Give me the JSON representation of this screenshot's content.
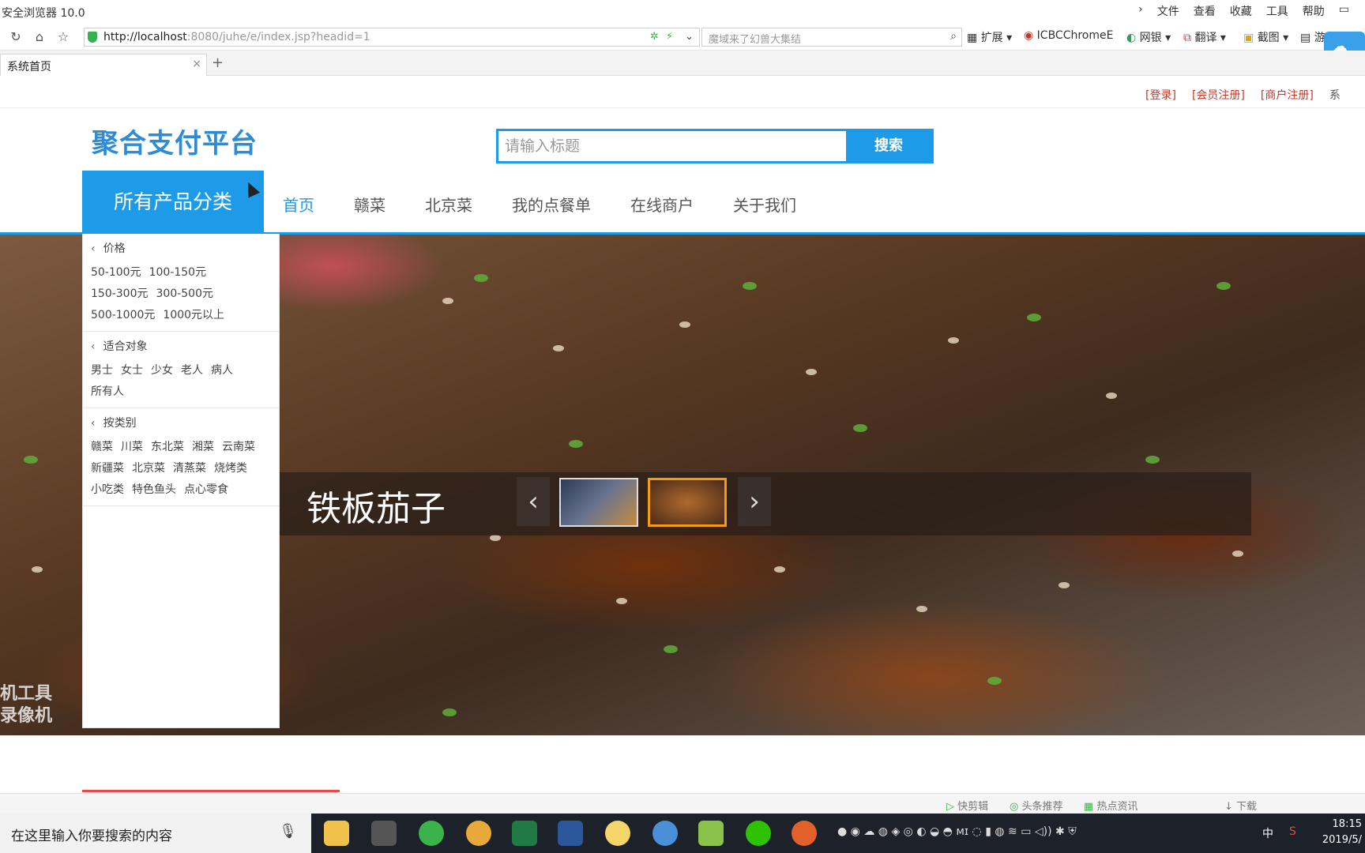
{
  "browser": {
    "title": "安全浏览器 10.0",
    "menu": [
      "文件",
      "查看",
      "收藏",
      "工具",
      "帮助"
    ],
    "url_host": "http://localhost",
    "url_path": ":8080/juhe/e/index.jsp?headid=1",
    "search_placeholder": "魔域来了幻兽大集结",
    "extensions": [
      "扩展",
      "ICBCChromeE",
      "网银",
      "翻译",
      "截图",
      "游戏"
    ],
    "tab_title": "系统首页"
  },
  "header": {
    "top_links": [
      "[登录]",
      "[会员注册]",
      "[商户注册]"
    ],
    "top_links_more": "系",
    "logo": "聚合支付平台",
    "search_placeholder": "请输入标题",
    "search_button": "搜索"
  },
  "nav": {
    "category_head": "所有产品分类",
    "items": [
      "首页",
      "赣菜",
      "北京菜",
      "我的点餐单",
      "在线商户",
      "关于我们"
    ],
    "active": "首页"
  },
  "sidebar": {
    "sections": [
      {
        "title": "价格",
        "items": [
          "50-100元",
          "100-150元",
          "150-300元",
          "300-500元",
          "500-1000元",
          "1000元以上"
        ]
      },
      {
        "title": "适合对象",
        "items": [
          "男士",
          "女士",
          "少女",
          "老人",
          "病人",
          "所有人"
        ]
      },
      {
        "title": "按类别",
        "items": [
          "赣菜",
          "川菜",
          "东北菜",
          "湘菜",
          "云南菜",
          "新疆菜",
          "北京菜",
          "清蒸菜",
          "烧烤类",
          "小吃类",
          "特色鱼头",
          "点心零食"
        ]
      }
    ]
  },
  "hero": {
    "caption": "铁板茄子",
    "watermark_line1": "机工具",
    "watermark_line2": "录像机"
  },
  "status_strip": [
    "快剪辑",
    "头条推荐",
    "热点资讯",
    "下载"
  ],
  "taskbar": {
    "search_placeholder": "在这里输入你要搜索的内容",
    "ime": "中",
    "time": "18:15",
    "date": "2019/5/"
  }
}
